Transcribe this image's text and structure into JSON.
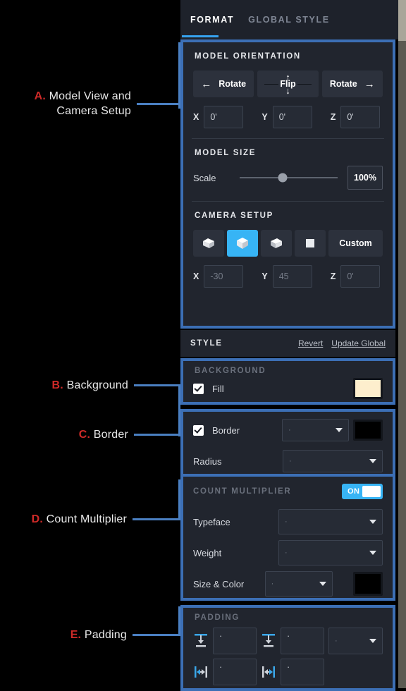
{
  "tabs": [
    {
      "label": "FORMAT",
      "active": true
    },
    {
      "label": "GLOBAL STYLE",
      "active": false
    }
  ],
  "annotations": [
    {
      "id": "A",
      "letter": "A.",
      "text": "Model View and\nCamera Setup"
    },
    {
      "id": "B",
      "letter": "B.",
      "text": "Background"
    },
    {
      "id": "C",
      "letter": "C.",
      "text": "Border"
    },
    {
      "id": "D",
      "letter": "D.",
      "text": "Count Multiplier"
    },
    {
      "id": "E",
      "letter": "E.",
      "text": "Padding"
    }
  ],
  "model_orientation": {
    "title": "MODEL ORIENTATION",
    "rotate_left_label": "Rotate",
    "rotate_left_arrow": "←",
    "flip_label": "Flip",
    "flip_up_arrow": "↑",
    "flip_down_arrow": "↓",
    "rotate_right_label": "Rotate",
    "rotate_right_arrow": "→",
    "x_label": "X",
    "x_value": "0'",
    "y_label": "Y",
    "y_value": "0'",
    "z_label": "Z",
    "z_value": "0'"
  },
  "model_size": {
    "title": "MODEL SIZE",
    "scale_label": "Scale",
    "scale_value": "100%"
  },
  "camera_setup": {
    "title": "CAMERA SETUP",
    "views": [
      {
        "name": "cube-view-left-icon",
        "selected": false
      },
      {
        "name": "cube-view-front-icon",
        "selected": true
      },
      {
        "name": "cube-view-right-icon",
        "selected": false
      },
      {
        "name": "square-flat-view-icon",
        "selected": false
      }
    ],
    "custom_label": "Custom",
    "x_label": "X",
    "x_value": "-30",
    "y_label": "Y",
    "y_value": "45",
    "z_label": "Z",
    "z_value": "0'"
  },
  "style_header": {
    "title": "STYLE",
    "revert_label": "Revert",
    "update_global_label": "Update Global"
  },
  "background": {
    "title": "BACKGROUND",
    "fill_label": "Fill",
    "fill_checked": true,
    "fill_color": "#fdeecd"
  },
  "border": {
    "border_label": "Border",
    "border_checked": true,
    "border_style_value": "·",
    "border_color": "#000000",
    "radius_label": "Radius",
    "radius_value": "·"
  },
  "count_multiplier": {
    "title": "COUNT MULTIPLIER",
    "toggle_label": "ON",
    "toggle_on": true,
    "typeface_label": "Typeface",
    "typeface_value": "·",
    "weight_label": "Weight",
    "weight_value": "·",
    "size_color_label": "Size & Color",
    "size_value": "·",
    "color_value": "#000000"
  },
  "padding": {
    "title": "PADDING",
    "top_value": "·",
    "bottom_value": "·",
    "unit_value": "·",
    "left_value": "·",
    "right_value": "·"
  },
  "colors": {
    "accent_blue": "#37b4f5",
    "highlight_blue": "#3c6fb5",
    "annotation_red": "#cf2a28",
    "panel_bg": "#21252e"
  }
}
